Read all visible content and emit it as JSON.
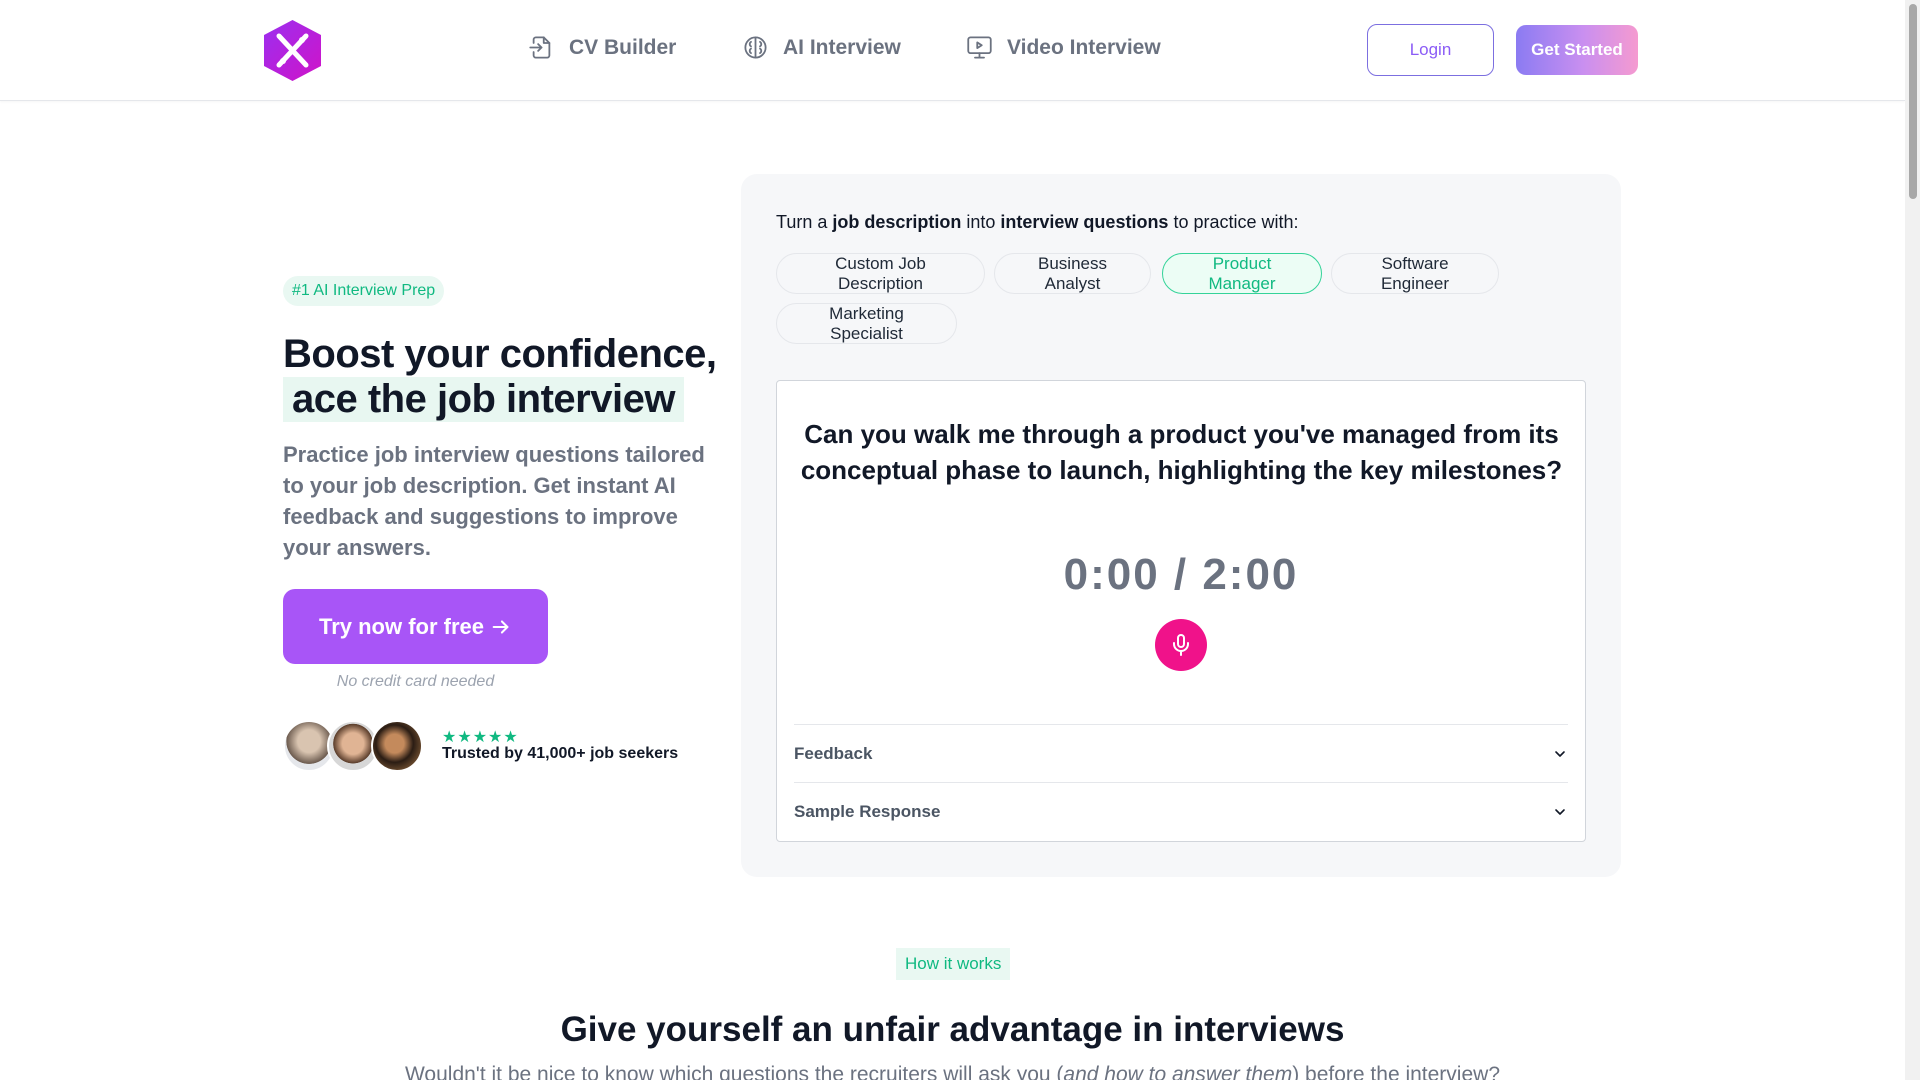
{
  "nav": {
    "links": [
      {
        "label": "CV Builder",
        "icon": "file-enter-icon"
      },
      {
        "label": "AI Interview",
        "icon": "brain-icon"
      },
      {
        "label": "Video Interview",
        "icon": "video-monitor-icon"
      }
    ],
    "login_label": "Login",
    "get_started_label": "Get Started"
  },
  "hero": {
    "badge": "#1 AI Interview Prep",
    "title_line1": "Boost your confidence,",
    "title_line2": "ace the job interview",
    "description": "Practice job interview questions tailored to your job description. Get instant AI feedback and suggestions to improve your answers.",
    "cta_label": "Try now for free",
    "cta_note": "No credit card needed",
    "rating_stars": 5,
    "trusted_text": "Trusted by 41,000+ job seekers"
  },
  "practice": {
    "intro_prefix": "Turn a ",
    "intro_bold1": "job description",
    "intro_mid": " into ",
    "intro_bold2": "interview questions",
    "intro_suffix": " to practice with:",
    "chips": [
      "Custom Job Description",
      "Business Analyst",
      "Product Manager",
      "Software Engineer",
      "Marketing Specialist"
    ],
    "selected_chip": "Product Manager",
    "question": "Can you walk me through a product you've managed from its conceptual phase to launch, highlighting the key milestones?",
    "timer": "0:00 / 2:00",
    "accordion": [
      {
        "label": "Feedback"
      },
      {
        "label": "Sample Response"
      }
    ]
  },
  "how_it_works": {
    "badge": "How it works",
    "title": "Give yourself an unfair advantage in interviews",
    "subtitle_prefix": "Wouldn't it be nice to know which questions the recruiters will ask you (",
    "subtitle_italic": "and how to answer them",
    "subtitle_suffix": ") before the interview?"
  },
  "colors": {
    "accent_purple": "#a855f7",
    "accent_green": "#10b981",
    "mic_pink": "#f0128a"
  }
}
